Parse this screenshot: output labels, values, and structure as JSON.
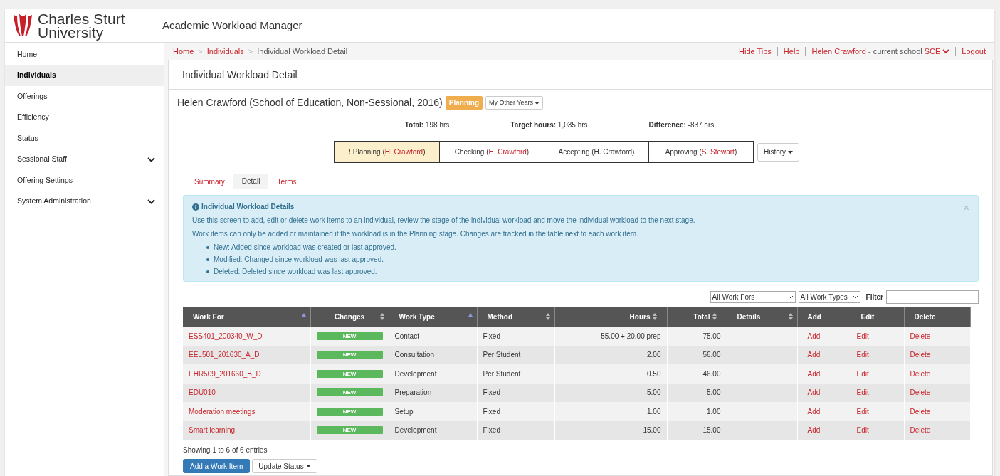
{
  "header": {
    "logo_line1": "Charles Sturt",
    "logo_line2": "University",
    "app_title": "Academic Workload Manager"
  },
  "sidebar": {
    "items": [
      {
        "label": "Home",
        "selected": false,
        "submenu": false
      },
      {
        "label": "Individuals",
        "selected": true,
        "submenu": false
      },
      {
        "label": "Offerings",
        "selected": false,
        "submenu": false
      },
      {
        "label": "Efficiency",
        "selected": false,
        "submenu": false
      },
      {
        "label": "Status",
        "selected": false,
        "submenu": false
      },
      {
        "label": "Sessional Staff",
        "selected": false,
        "submenu": true
      },
      {
        "label": "Offering Settings",
        "selected": false,
        "submenu": false
      },
      {
        "label": "System Administration",
        "selected": false,
        "submenu": true
      }
    ]
  },
  "breadcrumb": [
    {
      "label": "Home",
      "link": true,
      "separator": ">"
    },
    {
      "label": "Individuals",
      "link": true,
      "separator": ">"
    },
    {
      "label": "Individual Workload Detail",
      "link": false
    }
  ],
  "top_links": {
    "hide_tips": "Hide Tips",
    "help": "Help",
    "user": "Helen Crawford",
    "school_text": "- current school",
    "school": "SCE",
    "logout": "Logout"
  },
  "panel_title": "Individual Workload Detail",
  "person": {
    "heading": "Helen Crawford (School of Education, Non-Sessional, 2016)",
    "status": "Planning",
    "other_years": "My Other Years"
  },
  "totals": [
    {
      "label": "Total:",
      "value": "198 hrs"
    },
    {
      "label": "Target hours:",
      "value": "1,035 hrs"
    },
    {
      "label": "Difference:",
      "value": "-837 hrs"
    }
  ],
  "stages": [
    {
      "label": "Planning (",
      "person": "H. Crawford",
      "close": ")",
      "person_link": true,
      "current": true,
      "mark": "!"
    },
    {
      "label": "Checking (",
      "person": "H. Crawford",
      "close": ")",
      "person_link": true,
      "current": false
    },
    {
      "label": "Accepting (",
      "person": "H. Crawford",
      "close": ")",
      "person_link": false,
      "current": false
    },
    {
      "label": "Approving (",
      "person": "S. Stewart",
      "close": ")",
      "person_link": true,
      "current": false
    }
  ],
  "history_button": "History",
  "tabs": [
    {
      "label": "Summary",
      "selected": false
    },
    {
      "label": "Detail",
      "selected": true
    },
    {
      "label": "Terms",
      "selected": false
    }
  ],
  "info": {
    "title": "Individual Workload Details",
    "close": "×",
    "paragraphs": [
      "Use this screen to add, edit or delete work items to an individual, review the stage of the individual workload and move the individual workload to the next stage.",
      "Work items can only be added or maintained if the workload is in the Planning stage. Changes are tracked in the table next to each work item."
    ],
    "bullets": [
      "New: Added since workload was created or last approved.",
      "Modified: Changed since workload was last approved.",
      "Deleted: Deleted since workload was last approved."
    ]
  },
  "filters": {
    "work_for": "All Work Fors",
    "work_type": "All Work Types",
    "filter_label": "Filter"
  },
  "table": {
    "columns": [
      {
        "label": "Work For",
        "sortable": true,
        "sorted": true
      },
      {
        "label": "Changes",
        "sortable": true,
        "sorted": false
      },
      {
        "label": "Work Type",
        "sortable": true,
        "sorted": true
      },
      {
        "label": "Method",
        "sortable": true,
        "sorted": false
      },
      {
        "label": "Hours",
        "sortable": true,
        "sorted": false
      },
      {
        "label": "Total",
        "sortable": true,
        "sorted": false
      },
      {
        "label": "Details",
        "sortable": true,
        "sorted": false
      },
      {
        "label": "Add",
        "sortable": false
      },
      {
        "label": "Edit",
        "sortable": false
      },
      {
        "label": "Delete",
        "sortable": false
      }
    ],
    "rows": [
      {
        "work_for": "ESS401_200340_W_D",
        "change": "NEW",
        "work_type": "Contact",
        "method": "Fixed",
        "hours": "55.00 + 20.00 prep",
        "total": "75.00",
        "add": "Add",
        "edit": "Edit",
        "delete": "Delete"
      },
      {
        "work_for": "EEL501_201630_A_D",
        "change": "NEW",
        "work_type": "Consultation",
        "method": "Per Student",
        "hours": "2.00",
        "total": "56.00",
        "add": "Add",
        "edit": "Edit",
        "delete": "Delete"
      },
      {
        "work_for": "EHR509_201660_B_D",
        "change": "NEW",
        "work_type": "Development",
        "method": "Per Student",
        "hours": "0.50",
        "total": "46.00",
        "add": "Add",
        "edit": "Edit",
        "delete": "Delete"
      },
      {
        "work_for": "EDU010",
        "change": "NEW",
        "work_type": "Preparation",
        "method": "Fixed",
        "hours": "5.00",
        "total": "5.00",
        "add": "Add",
        "edit": "Edit",
        "delete": "Delete"
      },
      {
        "work_for": "Moderation meetings",
        "change": "NEW",
        "work_type": "Setup",
        "method": "Fixed",
        "hours": "1.00",
        "total": "1.00",
        "add": "Add",
        "edit": "Edit",
        "delete": "Delete"
      },
      {
        "work_for": "Smart learning",
        "change": "NEW",
        "work_type": "Development",
        "method": "Fixed",
        "hours": "15.00",
        "total": "15.00",
        "add": "Add",
        "edit": "Edit",
        "delete": "Delete"
      }
    ]
  },
  "showing": "Showing 1 to 6 of 6 entries",
  "buttons": {
    "add": "Add a Work Item",
    "update": "Update Status"
  }
}
